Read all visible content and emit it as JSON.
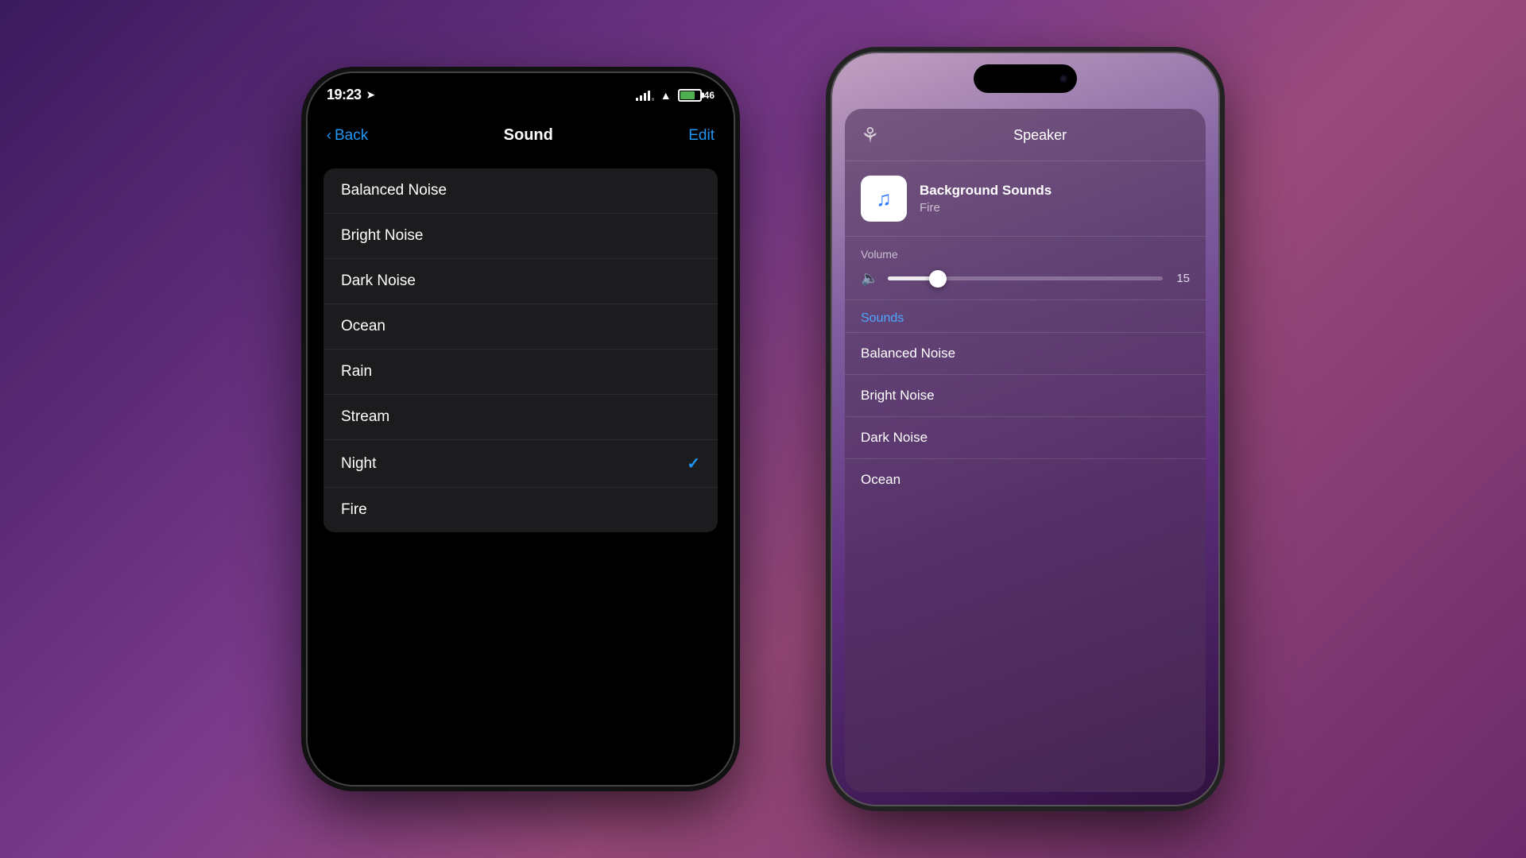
{
  "background": {
    "gradient": "linear-gradient(135deg, #3a1a5e, #7a3a8a, #9a4a7a, #6a2a6a)"
  },
  "phone1": {
    "status": {
      "time": "19:23",
      "battery_level": "46"
    },
    "nav": {
      "back_label": "Back",
      "title": "Sound",
      "edit_label": "Edit"
    },
    "sound_list": {
      "items": [
        {
          "label": "Balanced Noise",
          "checked": false
        },
        {
          "label": "Bright Noise",
          "checked": false
        },
        {
          "label": "Dark Noise",
          "checked": false
        },
        {
          "label": "Ocean",
          "checked": false
        },
        {
          "label": "Rain",
          "checked": false
        },
        {
          "label": "Stream",
          "checked": false
        },
        {
          "label": "Night",
          "checked": true
        },
        {
          "label": "Fire",
          "checked": false
        }
      ]
    }
  },
  "phone2": {
    "now_playing": {
      "source": "Speaker",
      "track_title": "Background Sounds",
      "track_sub": "Fire",
      "volume_label": "Volume",
      "volume_value": "15"
    },
    "sounds_section": {
      "header": "Sounds",
      "items": [
        {
          "label": "Balanced Noise"
        },
        {
          "label": "Bright Noise"
        },
        {
          "label": "Dark Noise"
        },
        {
          "label": "Ocean"
        }
      ]
    }
  }
}
